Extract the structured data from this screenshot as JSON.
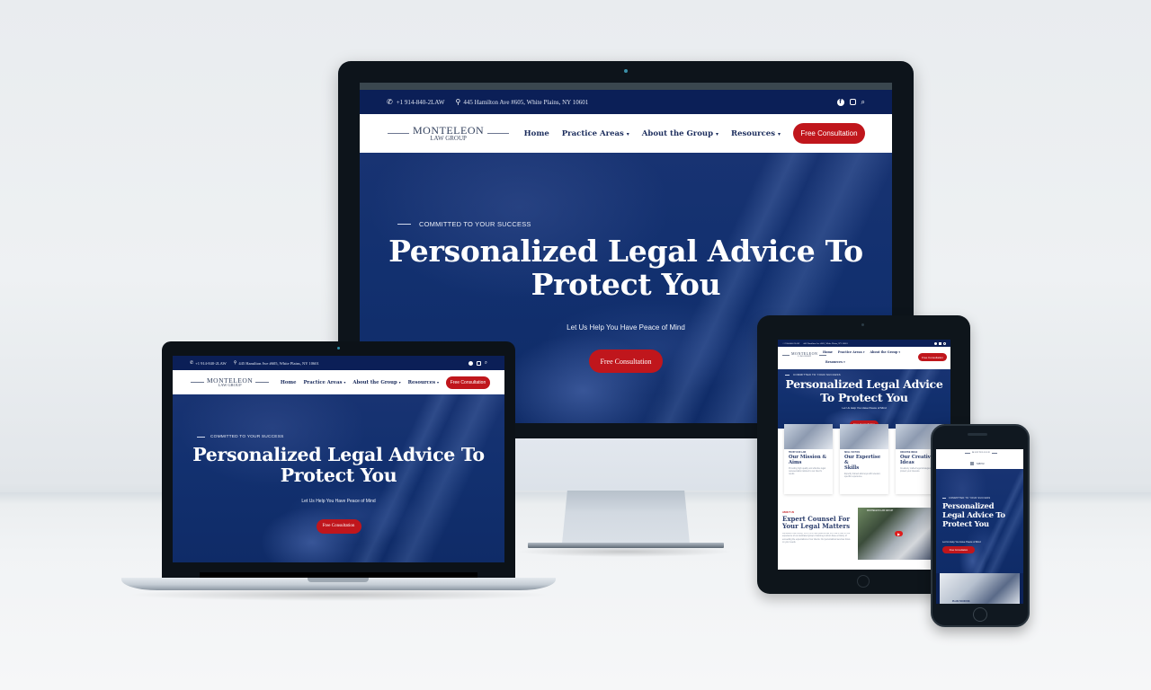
{
  "site": {
    "topbar": {
      "phone": "+1 914-840-2LAW",
      "address": "445 Hamilton Ave #605, White Plains, NY 10601",
      "icons": [
        "phone-icon",
        "map-pin-icon",
        "facebook-icon",
        "instagram-icon",
        "search-icon"
      ]
    },
    "logo": {
      "line1": "MONTELEON",
      "line2": "LAW GROUP"
    },
    "nav": {
      "items": [
        {
          "label": "Home",
          "dropdown": false
        },
        {
          "label": "Practice Areas",
          "dropdown": true
        },
        {
          "label": "About the Group",
          "dropdown": true
        },
        {
          "label": "Resources",
          "dropdown": true
        }
      ],
      "cta": "Free Consultation",
      "mobile_menu": "MENU"
    },
    "hero": {
      "eyebrow": "COMMITTED TO YOUR SUCCESS",
      "title_line1": "Personalized Legal Advice To",
      "title_line2": "Protect You",
      "tablet_line1": "Personalized Legal Advice",
      "tablet_line2": "To Protect You",
      "phone_line1": "Personalized",
      "phone_line2": "Legal Advice To",
      "phone_line3": "Protect You",
      "subtitle": "Let Us Help You Have Peace of Mind",
      "cta": "Free Consultation"
    },
    "cards": [
      {
        "kicker": "TRUST OUR LAW",
        "title_line1": "Our Mission &",
        "title_line2": "Aims",
        "text": "Providing high quality and effective legal representation tailored to our client's needs."
      },
      {
        "kicker": "SKILL TACTICS",
        "title_line1": "Our Expertise &",
        "title_line2": "Skills",
        "text": "Expertly trained attorneys with relevant, specific experience."
      },
      {
        "kicker": "CREATIVE IDEAS",
        "title_line1": "Our Creative",
        "title_line2": "Ideas",
        "text": "Creatively crafted legal strategies to protect your interests."
      }
    ],
    "about": {
      "kicker": "ABOUT US",
      "title_line1": "Expert Counsel For",
      "title_line2": "Your Legal Matters",
      "text": "Monteleon Law Group, PLLC is a multi-practice law firm that is built on the experience of our dedicated group of attorneys whom have a history of exceeding the expectations of our clients. Our personalized services focus on your needs.",
      "video_channel": "MONTELEON LAW GROUP"
    },
    "phone_card_label": "PLAN YOUR ISS"
  },
  "colors": {
    "navy": "#0b1f57",
    "accent_red": "#c0161c",
    "nav_text": "#1b2c5c"
  }
}
